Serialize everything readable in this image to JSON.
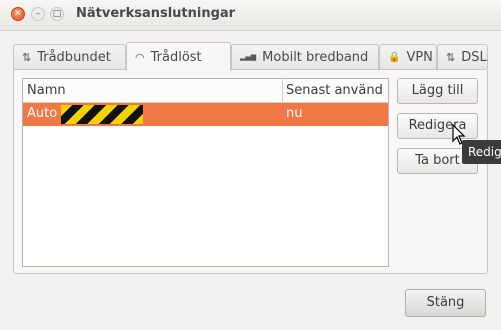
{
  "window": {
    "title": "Nätverksanslutningar"
  },
  "tabs": [
    {
      "label": "Trådbundet",
      "icon": "wired-arrows-icon",
      "glyph": "⇅"
    },
    {
      "label": "Trådlöst",
      "icon": "wifi-icon",
      "glyph": "◠"
    },
    {
      "label": "Mobilt bredband",
      "icon": "signal-bars-icon",
      "glyph": "▂▄▆"
    },
    {
      "label": "VPN",
      "icon": "lock-icon",
      "glyph": "🔒"
    },
    {
      "label": "DSL",
      "icon": "dsl-arrows-icon",
      "glyph": "⇅"
    }
  ],
  "active_tab": "Trådlöst",
  "list": {
    "columns": [
      "Namn",
      "Senast använd"
    ],
    "rows": [
      {
        "name": "Auto",
        "last_used": "nu",
        "selected": true
      }
    ]
  },
  "buttons": {
    "add": "Lägg till",
    "edit": "Redigera",
    "delete": "Ta bort",
    "close": "Stäng"
  },
  "tooltip": "Redigera",
  "colors": {
    "selection": "#f07746",
    "close_button": "#e0501e"
  }
}
